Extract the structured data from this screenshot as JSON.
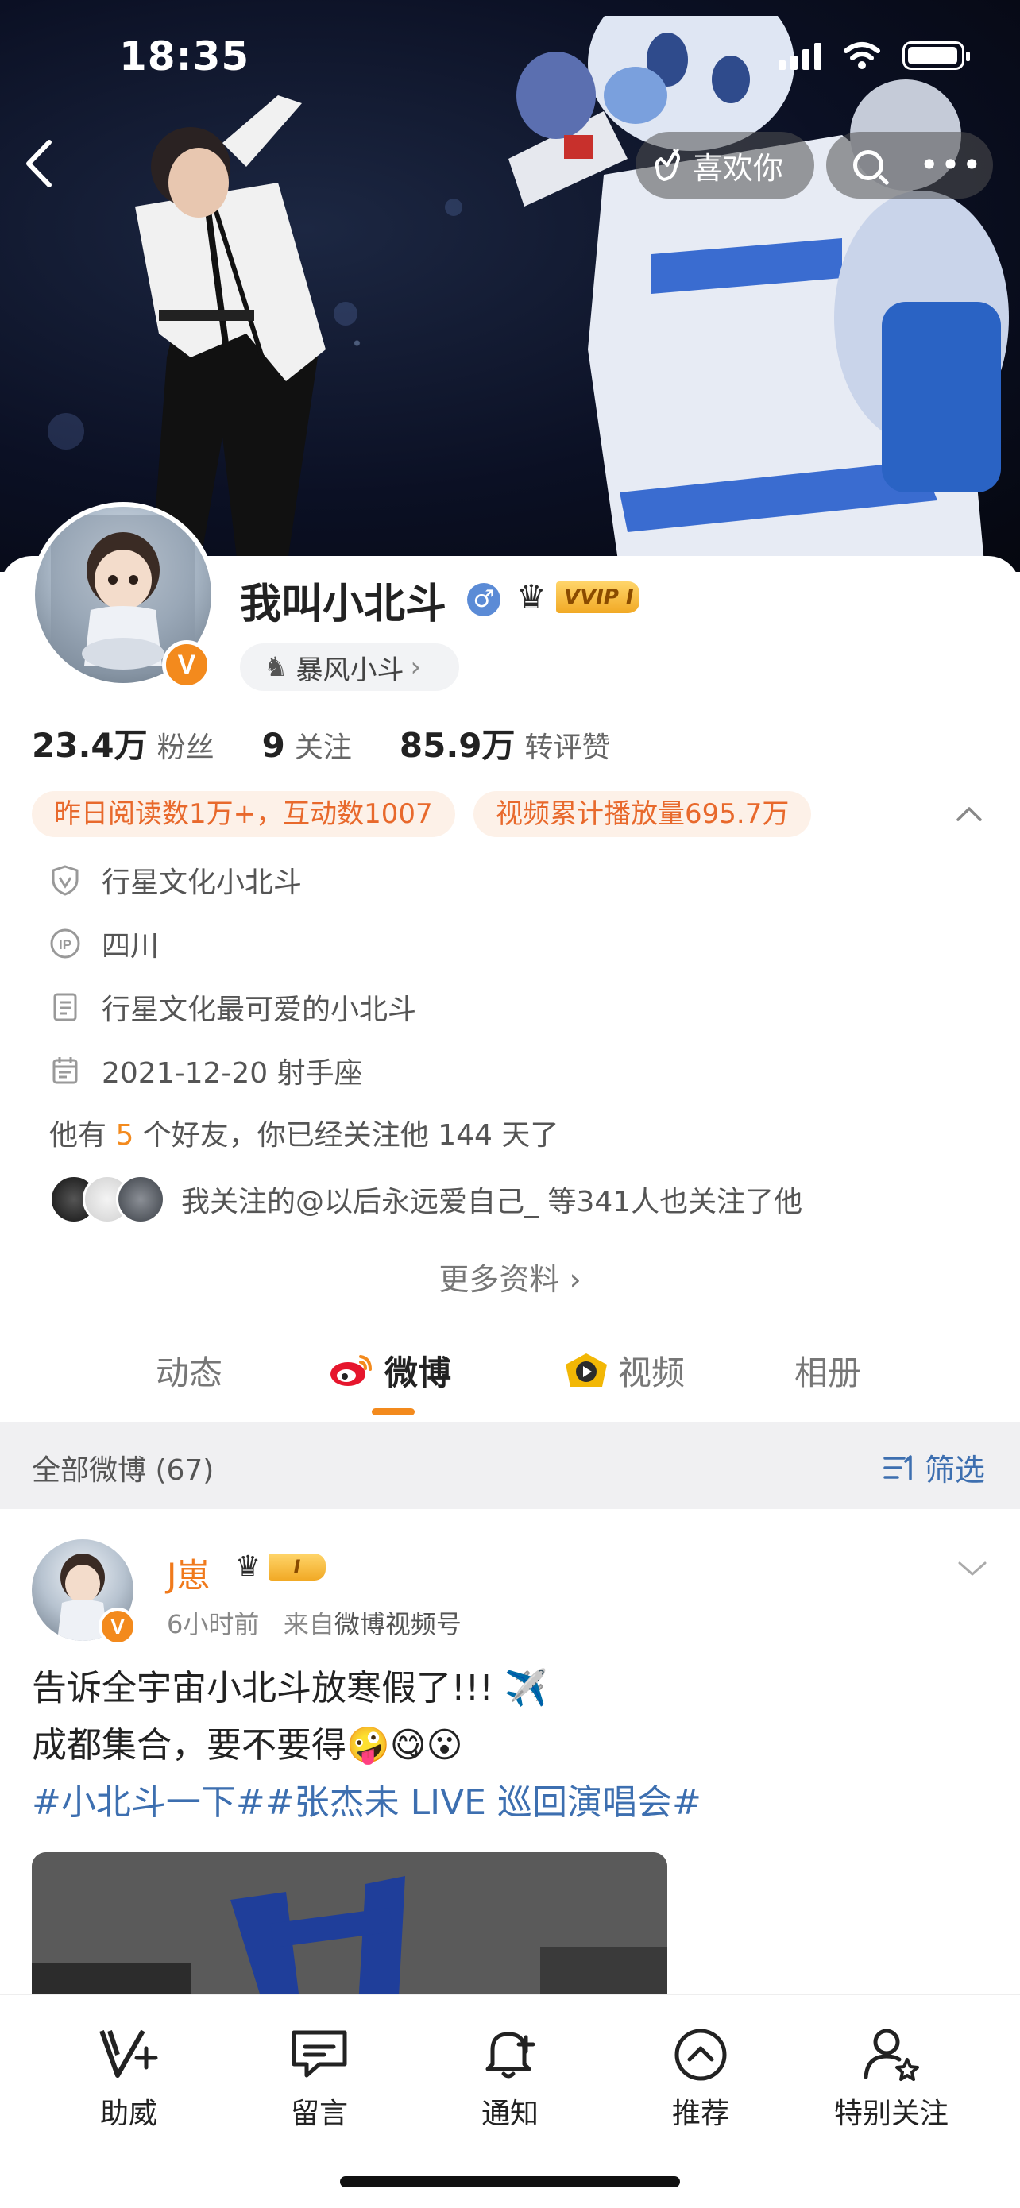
{
  "status_bar": {
    "time": "18:35"
  },
  "header": {
    "like_label": "喜欢你"
  },
  "profile": {
    "name": "我叫小北斗",
    "vip_label": "VVIP I",
    "verified_letter": "V",
    "group_label": "暴风小斗",
    "stats": [
      {
        "value": "23.4万",
        "label": "粉丝"
      },
      {
        "value": "9",
        "label": "关注"
      },
      {
        "value": "85.9万",
        "label": "转评赞"
      }
    ],
    "highlights": [
      "昨日阅读数1万+，互动数1007",
      "视频累计播放量695.7万"
    ],
    "info": [
      {
        "icon": "shield-icon",
        "text": "行星文化小北斗"
      },
      {
        "icon": "ip-location-icon",
        "text": "四川"
      },
      {
        "icon": "document-icon",
        "text": "行星文化最可爱的小北斗"
      },
      {
        "icon": "calendar-icon",
        "text": "2021-12-20 射手座"
      }
    ],
    "friends": {
      "prefix": "他有 ",
      "count": "5",
      "suffix": " 个好友，你已经关注他 144 天了"
    },
    "mutual_follow": "我关注的@以后永远爱自己_ 等341人也关注了他",
    "more_info": "更多资料 ›"
  },
  "tabs": [
    {
      "label": "动态",
      "active": false
    },
    {
      "label": "微博",
      "active": true
    },
    {
      "label": "视频",
      "active": false
    },
    {
      "label": "相册",
      "active": false
    }
  ],
  "filter": {
    "all_label": "全部微博 (67)",
    "filter_label": "筛选"
  },
  "post": {
    "author": "J崽",
    "level": "I",
    "time": "6小时前",
    "from_prefix": "来自",
    "source": "微博视频号",
    "line1": "告诉全宇宙小北斗放寒假了!!! ✈️",
    "line2": "成都集合，要不要得🤪😋😮",
    "hashtag1": "#小北斗一下#",
    "hashtag2": "#张杰未 LIVE 巡回演唱会#"
  },
  "toolbar": [
    {
      "icon": "assist-icon",
      "label": "助威"
    },
    {
      "icon": "message-icon",
      "label": "留言"
    },
    {
      "icon": "bell-plus-icon",
      "label": "通知"
    },
    {
      "icon": "recommend-icon",
      "label": "推荐"
    },
    {
      "icon": "special-follow-icon",
      "label": "特别关注"
    }
  ],
  "colors": {
    "accent_orange": "#f38a1d",
    "link_blue": "#3d6fb0",
    "highlight_chip_bg": "#fdf1e8",
    "highlight_chip_text": "#e8692c"
  }
}
